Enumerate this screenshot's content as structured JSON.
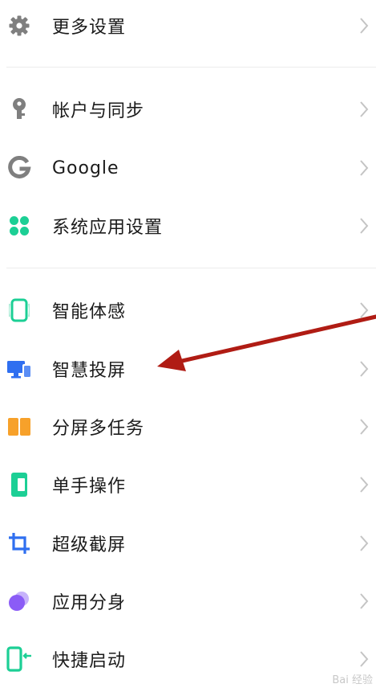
{
  "items": [
    {
      "label": "更多设置",
      "icon": "gear-icon",
      "color": "#7f7f7f"
    },
    {
      "label": "帐户与同步",
      "icon": "key-icon",
      "color": "#7f7f7f"
    },
    {
      "label": "Google",
      "icon": "google-icon",
      "color": "#7f7f7f"
    },
    {
      "label": "系统应用设置",
      "icon": "clover-icon",
      "color": "#1ccf95"
    },
    {
      "label": "智能体感",
      "icon": "phone-motion-icon",
      "color": "#1ccf95"
    },
    {
      "label": "智慧投屏",
      "icon": "screen-cast-icon",
      "color": "#2f6ff0"
    },
    {
      "label": "分屏多任务",
      "icon": "split-screen-icon",
      "color": "#f7a12a"
    },
    {
      "label": "单手操作",
      "icon": "one-hand-icon",
      "color": "#1ccf95"
    },
    {
      "label": "超级截屏",
      "icon": "crop-icon",
      "color": "#2f6ff0"
    },
    {
      "label": "应用分身",
      "icon": "app-clone-icon",
      "color": "#8b5cf6"
    },
    {
      "label": "快捷启动",
      "icon": "quick-launch-icon",
      "color": "#1ccf95"
    }
  ],
  "annotation": {
    "arrow_color": "#b01c14"
  },
  "watermark": "Bai 经验"
}
